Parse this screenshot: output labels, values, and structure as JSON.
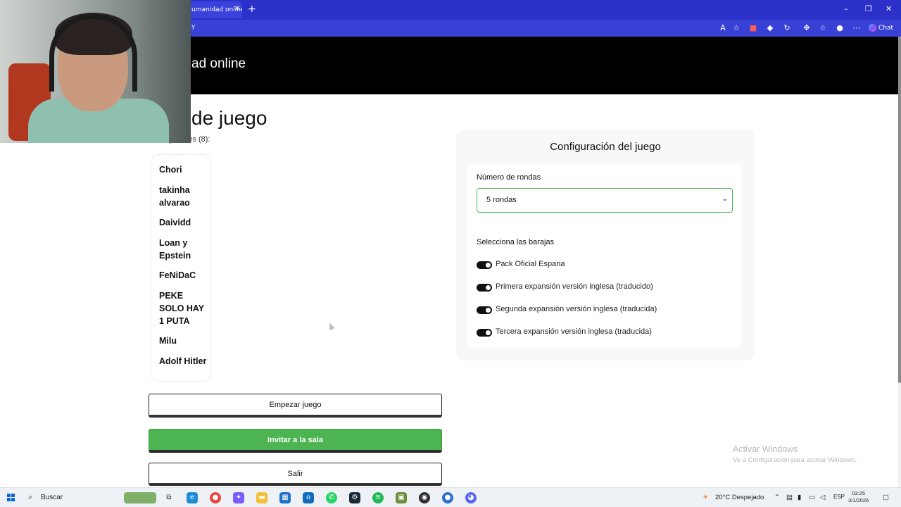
{
  "browser": {
    "tab_title": "umanidad online",
    "tab_close": "✕",
    "new_tab": "+",
    "url": "y",
    "chat_label": "Chat",
    "window_controls": {
      "minimize": "–",
      "maximize": "❐",
      "close": "✕"
    }
  },
  "site": {
    "title": "ad online"
  },
  "page": {
    "title": "de juego",
    "players_heading": "...gadores (8):"
  },
  "players": [
    "Chori",
    "takinha alvarao",
    "Daividd",
    "Loan y Epstein",
    "FeNiDaC",
    "PEKE SOLO HAY 1 PUTA",
    "Milu",
    "Adolf Hitler"
  ],
  "buttons": {
    "start": "Empezar juego",
    "invite": "Invitar a la sala",
    "exit": "Salir"
  },
  "config": {
    "title": "Configuración del juego",
    "rounds_label": "Número de rondas",
    "rounds_value": "5 rondas",
    "decks_label": "Selecciona las barajas",
    "decks": [
      {
        "label": "Pack Oficial Espana",
        "enabled": true
      },
      {
        "label": "Primera expansión versión inglesa (traducido)",
        "enabled": true
      },
      {
        "label": "Segunda expansión versión inglesa (traducida)",
        "enabled": true
      },
      {
        "label": "Tercera expansión versión inglesa (traducida)",
        "enabled": true
      }
    ]
  },
  "windows": {
    "activate_title": "Activar Windows",
    "activate_subtitle": "Ve a Configuración para activar Windows."
  },
  "taskbar": {
    "search_placeholder": "Buscar",
    "weather": "20°C Despejado",
    "language": "ESP",
    "time": "03:25",
    "date": "3/1/2026"
  },
  "colors": {
    "accent_green": "#4cb551",
    "browser_blue": "#2b31c8"
  }
}
